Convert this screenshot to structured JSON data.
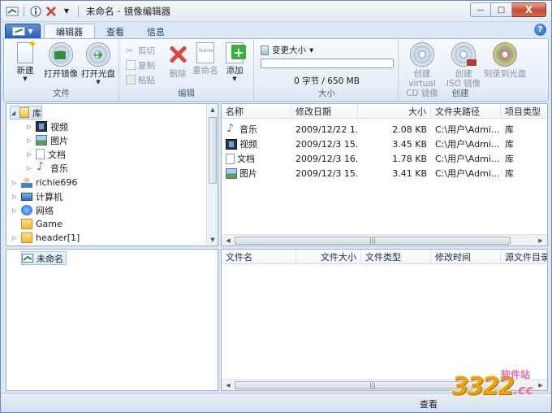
{
  "window": {
    "title": "未命名 - 镜像编辑器",
    "title_parts": [
      "未命名",
      "-",
      "镜像编辑器"
    ]
  },
  "quick_access": {
    "app_icon": "image-editor-icon",
    "info_icon": "info-icon",
    "delete_icon": "red-x-icon",
    "dropdown_icon": "chevron-down-icon"
  },
  "window_controls": {
    "minimize": "—",
    "maximize": "□",
    "close": "X"
  },
  "ribbon_tabs": [
    {
      "label": "编辑器",
      "active": true
    },
    {
      "label": "查看",
      "active": false
    },
    {
      "label": "信息",
      "active": false
    }
  ],
  "help": "?",
  "ribbon": {
    "file_group": {
      "label": "文件",
      "new_label": "新建",
      "open_image_label": "打开镜像",
      "open_disc_label": "打开光盘"
    },
    "edit_group": {
      "label": "编辑",
      "cut_label": "剪切",
      "copy_label": "复制",
      "paste_label": "粘贴",
      "delete_label": "删除",
      "rename_label": "重命名",
      "add_label": "添加",
      "rename_icon_text": "Name"
    },
    "size_group": {
      "label": "大小",
      "change_size_label": "变更大小",
      "dropdown_arrow": "▾",
      "progress_fraction": 0.0,
      "size_text": "0 字节 / 650 MB"
    },
    "create_group": {
      "label": "创建",
      "create_cd_label_1": "创建 virtual",
      "create_cd_label_2": "CD 镜像",
      "create_iso_label_1": "创建",
      "create_iso_label_2": "ISO 镜像",
      "burn_label": "刻录到光盘"
    }
  },
  "tree": {
    "items": [
      {
        "label": "库",
        "expander": "◢",
        "icon": "library-icon"
      },
      {
        "label": "视频",
        "expander": "▷",
        "icon": "video-icon"
      },
      {
        "label": "图片",
        "expander": "▷",
        "icon": "picture-icon"
      },
      {
        "label": "文档",
        "expander": "▷",
        "icon": "document-icon"
      },
      {
        "label": "音乐",
        "expander": "▷",
        "icon": "music-icon"
      },
      {
        "label": "richie696",
        "expander": "▷",
        "icon": "user-icon"
      },
      {
        "label": "计算机",
        "expander": "▷",
        "icon": "computer-icon"
      },
      {
        "label": "网络",
        "expander": "▷",
        "icon": "network-icon"
      },
      {
        "label": "Game",
        "expander": "",
        "icon": "folder-icon"
      },
      {
        "label": "header[1]",
        "expander": "▷",
        "icon": "folder-icon"
      }
    ]
  },
  "file_list": {
    "columns": [
      "名称",
      "修改日期",
      "大小",
      "文件夹路径",
      "项目类型"
    ],
    "rows": [
      {
        "name": "音乐",
        "date": "2009/12/22 1...",
        "size": "2.08 KB",
        "path": "C:\\用户\\Admi...",
        "type": "库",
        "icon": "music-icon"
      },
      {
        "name": "视频",
        "date": "2009/12/3 15...",
        "size": "3.45 KB",
        "path": "C:\\用户\\Admi...",
        "type": "库",
        "icon": "video-icon"
      },
      {
        "name": "文档",
        "date": "2009/12/3 16...",
        "size": "1.78 KB",
        "path": "C:\\用户\\Admi...",
        "type": "库",
        "icon": "document-icon"
      },
      {
        "name": "图片",
        "date": "2009/12/3 15...",
        "size": "3.41 KB",
        "path": "C:\\用户\\Admi...",
        "type": "库",
        "icon": "picture-icon"
      }
    ]
  },
  "image_tree": {
    "root_label": "未命名",
    "root_icon": "image-editor-icon"
  },
  "image_contents": {
    "columns": [
      "文件名",
      "文件大小",
      "文件类型",
      "修改时间",
      "源文件目录"
    ]
  },
  "scroll": {
    "grip": "|||",
    "left_arrow": "◀",
    "right_arrow": "▶",
    "up_arrow": "▲",
    "down_arrow": "▼"
  },
  "statusbar": {
    "view_label": "查看"
  },
  "watermark": {
    "number": "3322",
    "suffix": ".cc",
    "site": "软件站"
  }
}
